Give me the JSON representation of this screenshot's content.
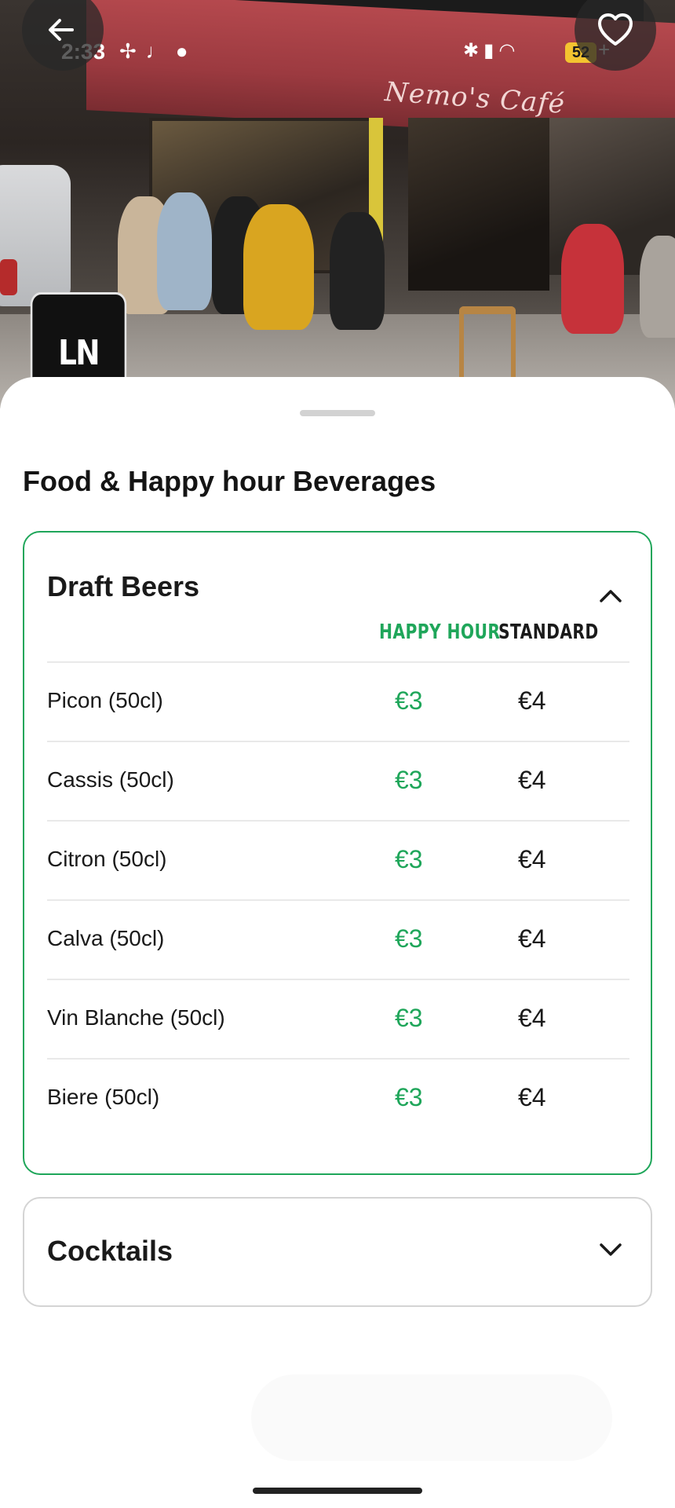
{
  "status_bar": {
    "time": "2:33",
    "battery": "52",
    "battery_suffix": "+",
    "left_icons": [
      "fan-icon",
      "j-icon",
      "location-icon"
    ],
    "right_icons": [
      "bluetooth-icon",
      "signal-icon",
      "wifi-icon"
    ]
  },
  "hero": {
    "awning_text": "Nemo's Café",
    "logo_text": "LN"
  },
  "sheet": {
    "title": "Food & Happy hour Beverages"
  },
  "sections": [
    {
      "title": "Draft Beers",
      "expanded": true,
      "columns": {
        "happy_hour": "HAPPY HOUR",
        "standard": "STANDARD"
      },
      "items": [
        {
          "name": "Picon (50cl)",
          "happy_hour": "€3",
          "standard": "€4"
        },
        {
          "name": "Cassis (50cl)",
          "happy_hour": "€3",
          "standard": "€4"
        },
        {
          "name": "Citron (50cl)",
          "happy_hour": "€3",
          "standard": "€4"
        },
        {
          "name": "Calva (50cl)",
          "happy_hour": "€3",
          "standard": "€4"
        },
        {
          "name": "Vin Blanche (50cl)",
          "happy_hour": "€3",
          "standard": "€4"
        },
        {
          "name": "Biere (50cl)",
          "happy_hour": "€3",
          "standard": "€4"
        }
      ]
    },
    {
      "title": "Cocktails",
      "expanded": false
    }
  ],
  "colors": {
    "accent_green": "#1fa65a",
    "text": "#1a1a1a",
    "awning_red": "#9c3a40"
  }
}
